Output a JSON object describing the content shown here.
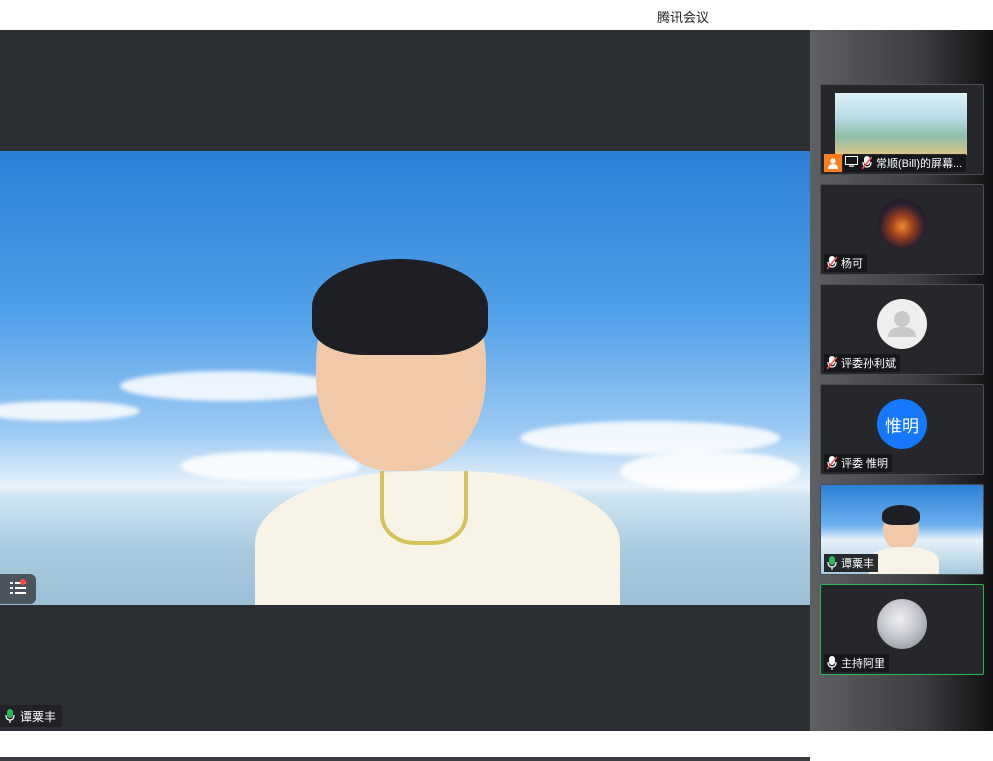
{
  "window": {
    "title": "腾讯会议"
  },
  "main": {
    "speaker": {
      "name": "谭粟丰",
      "mic_state": "active"
    },
    "chat_button_icon": "list-icon"
  },
  "participants": [
    {
      "name": "常顺(Bill)的屏幕...",
      "type": "screen-share",
      "mic_state": "muted",
      "avatar_icon": "person-icon",
      "share_icon": "screen-share-icon"
    },
    {
      "name": "杨可",
      "type": "photo",
      "mic_state": "muted",
      "avatar_icon": "sunset-avatar"
    },
    {
      "name": "评委孙利斌",
      "type": "default",
      "mic_state": "muted",
      "avatar_icon": "default-user-icon"
    },
    {
      "name": "评委 惟明",
      "type": "initials",
      "avatar_text": "惟明",
      "mic_state": "muted"
    },
    {
      "name": "谭粟丰",
      "type": "video",
      "mic_state": "active"
    },
    {
      "name": "主持阿里",
      "type": "photo",
      "mic_state": "on",
      "active": true
    }
  ],
  "colors": {
    "background": "#2b2e33",
    "sidebar": "#3c3e41",
    "active_border": "#2ab55a",
    "mic_active": "#2ab55a",
    "mic_muted": "#ff4d4d",
    "initials_avatar": "#1677ff",
    "share_badge": "#ff7d1a"
  }
}
